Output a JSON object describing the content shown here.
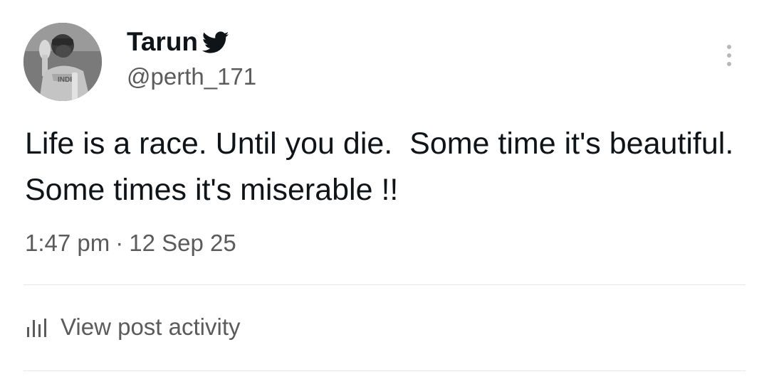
{
  "author": {
    "display_name": "Tarun",
    "handle": "@perth_171",
    "badge_icon": "twitter-bird-icon",
    "avatar_jersey_text": "INDIA"
  },
  "post": {
    "text": "Life is a race. Until you die.  Some time it's beautiful. Some times it's miserable !!",
    "time": "1:47 pm",
    "separator": "·",
    "date": "12 Sep 25"
  },
  "actions": {
    "more_icon": "more-vertical-icon",
    "activity_icon": "bar-chart-icon",
    "view_activity_label": "View post activity"
  },
  "colors": {
    "primary_text": "#0f1419",
    "secondary_text": "#5b5b5b",
    "divider": "#e6e6e6"
  }
}
